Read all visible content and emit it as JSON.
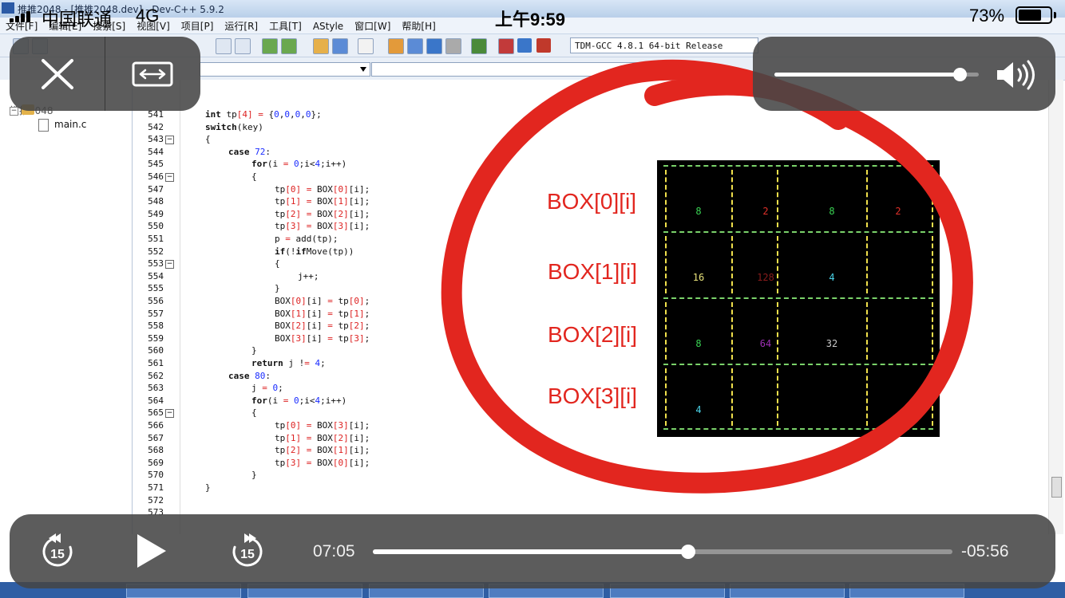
{
  "status_bar": {
    "carrier": "中国联通",
    "network": "4G",
    "time": "上午9:59",
    "battery": "73%",
    "battery_level": 0.73
  },
  "ide": {
    "window_title": "推推2048 - [推推2048.dev] - Dev-C++ 5.9.2",
    "menu": [
      "文件[F]",
      "编辑[E]",
      "搜索[S]",
      "视图[V]",
      "项目[P]",
      "运行[R]",
      "工具[T]",
      "AStyle",
      "窗口[W]",
      "帮助[H]"
    ],
    "compiler": "TDM-GCC 4.8.1 64-bit Release",
    "project_tree": {
      "root": "推推2048",
      "file": "main.c"
    },
    "code_lines": [
      {
        "n": "541",
        "text": "int tp[4] = {0,0,0,0};",
        "indent": 1
      },
      {
        "n": "542",
        "text": "switch(key)",
        "indent": 1
      },
      {
        "n": "543",
        "text": "{",
        "indent": 1
      },
      {
        "n": "544",
        "text": "case 72:",
        "indent": 2
      },
      {
        "n": "545",
        "text": "for(i = 0;i<4;i++)",
        "indent": 3
      },
      {
        "n": "546",
        "text": "{",
        "indent": 3
      },
      {
        "n": "547",
        "text": "tp[0] = BOX[0][i];",
        "indent": 4
      },
      {
        "n": "548",
        "text": "tp[1] = BOX[1][i];",
        "indent": 4
      },
      {
        "n": "549",
        "text": "tp[2] = BOX[2][i];",
        "indent": 4
      },
      {
        "n": "550",
        "text": "tp[3] = BOX[3][i];",
        "indent": 4
      },
      {
        "n": "551",
        "text": "p = add(tp);",
        "indent": 4
      },
      {
        "n": "552",
        "text": "if(!ifMove(tp))",
        "indent": 4
      },
      {
        "n": "553",
        "text": "{",
        "indent": 4
      },
      {
        "n": "554",
        "text": "j++;",
        "indent": 5
      },
      {
        "n": "555",
        "text": "}",
        "indent": 4
      },
      {
        "n": "556",
        "text": "BOX[0][i] = tp[0];",
        "indent": 4
      },
      {
        "n": "557",
        "text": "BOX[1][i] = tp[1];",
        "indent": 4
      },
      {
        "n": "558",
        "text": "BOX[2][i] = tp[2];",
        "indent": 4
      },
      {
        "n": "559",
        "text": "BOX[3][i] = tp[3];",
        "indent": 4
      },
      {
        "n": "560",
        "text": "}",
        "indent": 3
      },
      {
        "n": "561",
        "text": "return j != 4;",
        "indent": 3
      },
      {
        "n": "562",
        "text": "case 80:",
        "indent": 2
      },
      {
        "n": "563",
        "text": "j = 0;",
        "indent": 3
      },
      {
        "n": "564",
        "text": "for(i = 0;i<4;i++)",
        "indent": 3
      },
      {
        "n": "565",
        "text": "{",
        "indent": 3
      },
      {
        "n": "566",
        "text": "tp[0] = BOX[3][i];",
        "indent": 4
      },
      {
        "n": "567",
        "text": "tp[1] = BOX[2][i];",
        "indent": 4
      },
      {
        "n": "568",
        "text": "tp[2] = BOX[1][i];",
        "indent": 4
      },
      {
        "n": "569",
        "text": "tp[3] = BOX[0][i];",
        "indent": 4
      },
      {
        "n": "570",
        "text": "}",
        "indent": 3
      },
      {
        "n": "571",
        "text": "}",
        "indent": 1
      },
      {
        "n": "572",
        "text": "",
        "indent": 0
      },
      {
        "n": "573",
        "text": "",
        "indent": 0
      }
    ],
    "fold_lines": [
      "543",
      "546",
      "553",
      "565"
    ]
  },
  "board": {
    "row_labels": [
      "BOX[0][i]",
      "BOX[1][i]",
      "BOX[2][i]",
      "BOX[3][i]"
    ],
    "rows": [
      [
        {
          "v": "8",
          "c": "#39d353"
        },
        {
          "v": "2",
          "c": "#e0302a"
        },
        {
          "v": "8",
          "c": "#39d353"
        },
        {
          "v": "2",
          "c": "#e0302a"
        }
      ],
      [
        {
          "v": "16",
          "c": "#e8e27a"
        },
        {
          "v": "128",
          "c": "#8a1c1c"
        },
        {
          "v": "4",
          "c": "#4ad3e8"
        },
        {
          "v": "",
          "c": "#fff"
        }
      ],
      [
        {
          "v": "8",
          "c": "#39d353"
        },
        {
          "v": "64",
          "c": "#9b2fb3"
        },
        {
          "v": "32",
          "c": "#c8c8c8"
        },
        {
          "v": "",
          "c": "#fff"
        }
      ],
      [
        {
          "v": "4",
          "c": "#4ad3e8"
        },
        {
          "v": "",
          "c": "#fff"
        },
        {
          "v": "",
          "c": "#fff"
        },
        {
          "v": "",
          "c": "#fff"
        }
      ]
    ]
  },
  "player": {
    "elapsed": "07:05",
    "remaining": "-05:56",
    "progress": 0.544,
    "volume": 0.907,
    "skip_back_seconds": "15",
    "skip_forward_seconds": "15"
  },
  "colors": {
    "annotation_red": "#e2261f",
    "current_line": "#ccf7fb"
  },
  "icons": [
    "signal-icon",
    "battery-icon",
    "close-icon",
    "aspect-ratio-icon",
    "speaker-icon",
    "skip-back-15-icon",
    "play-icon",
    "skip-forward-15-icon"
  ]
}
